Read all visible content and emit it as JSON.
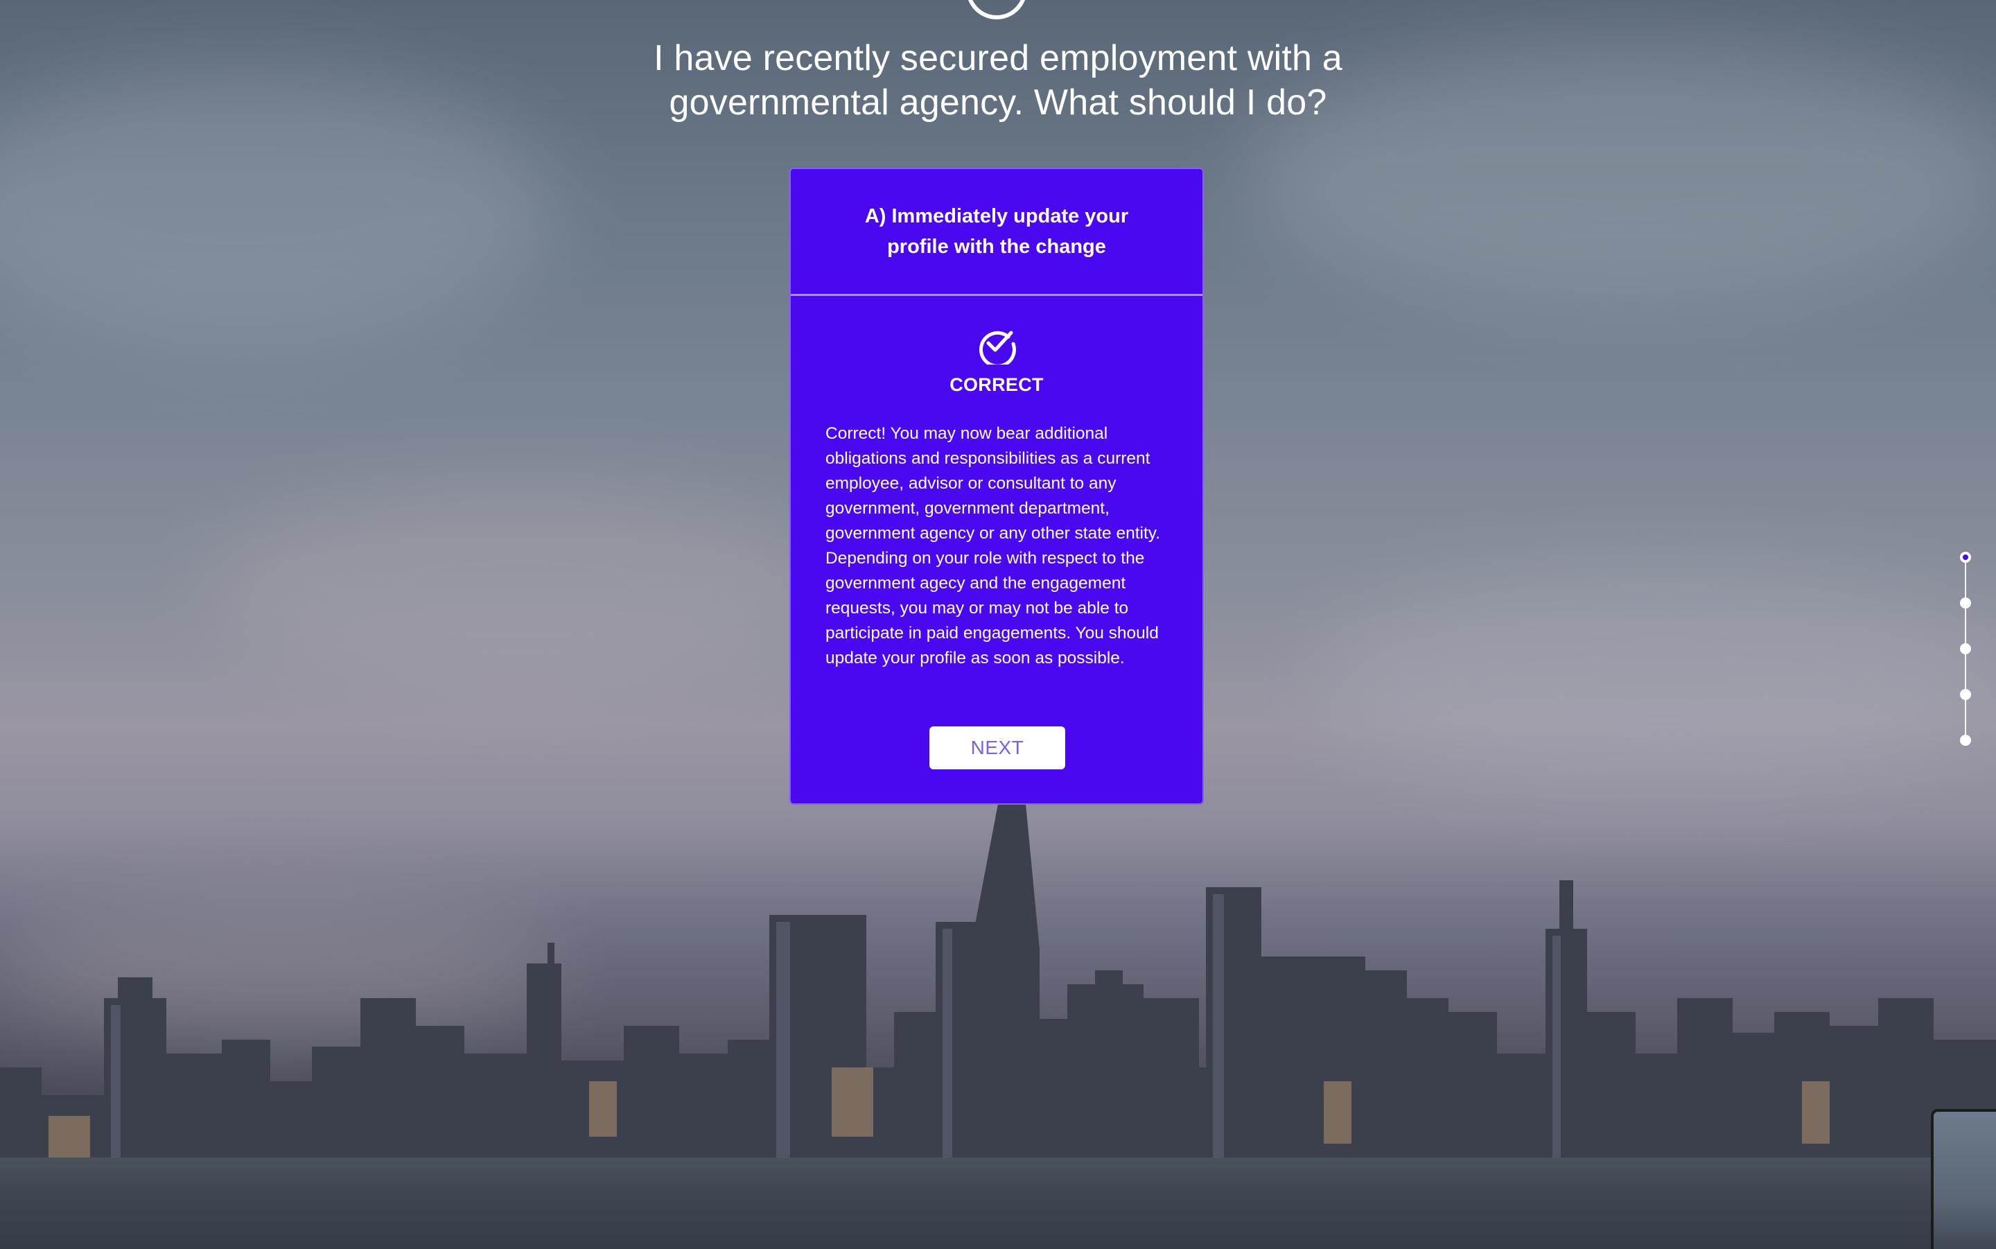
{
  "question": {
    "text": "I have recently secured employment with a governmental agency. What should I do?"
  },
  "answer_card": {
    "selected_answer": "A) Immediately update your profile with the change",
    "status_icon": "check-circle-icon",
    "status_label": "CORRECT",
    "explanation": "Correct! You may now bear additional obligations and responsibilities as a current employee, advisor or consultant to any government, government department, government agency or any other state entity. Depending on your role with respect to the government agecy and the engagement requests, you may or may not be able to participate in paid engagements. You should update your profile as soon as possible.",
    "next_label": "NEXT"
  },
  "progress": {
    "total_steps": 5,
    "current_step": 1
  },
  "colors": {
    "card_background": "#4a08f1",
    "button_text": "#7d5df2",
    "text": "#ffffff"
  }
}
